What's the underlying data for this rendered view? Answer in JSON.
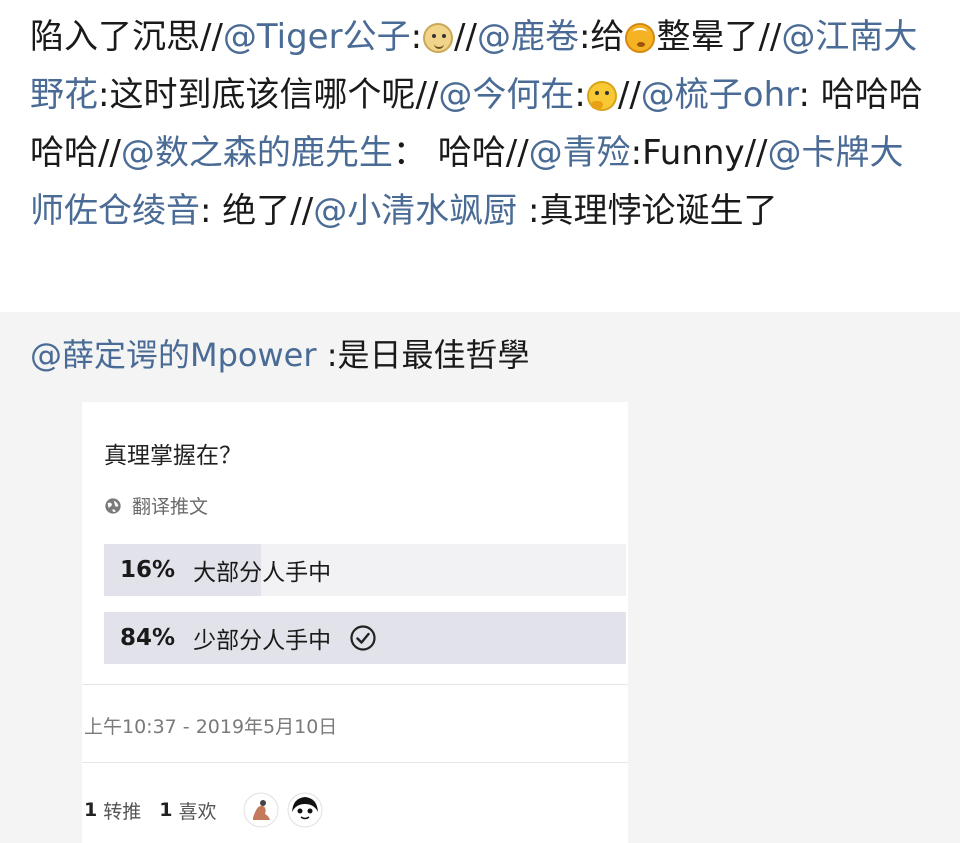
{
  "repost": {
    "segments": [
      {
        "type": "text",
        "text": "陷入了沉思"
      },
      {
        "type": "sep",
        "text": "//"
      },
      {
        "type": "mention",
        "text": "@Tiger公子"
      },
      {
        "type": "text",
        "text": ":"
      },
      {
        "type": "emoji",
        "icon": "doge-emoji-icon",
        "variant": "doge"
      },
      {
        "type": "sep",
        "text": "//"
      },
      {
        "type": "mention",
        "text": "@鹿卷"
      },
      {
        "type": "text",
        "text": ":给"
      },
      {
        "type": "emoji",
        "icon": "dizzy-face-emoji-icon",
        "variant": "dizzy"
      },
      {
        "type": "text",
        "text": "整晕了"
      },
      {
        "type": "sep",
        "text": "//"
      },
      {
        "type": "mention",
        "text": "@江南大野花"
      },
      {
        "type": "text",
        "text": ":这时到底该信哪个呢"
      },
      {
        "type": "sep",
        "text": "//"
      },
      {
        "type": "mention",
        "text": "@今何在"
      },
      {
        "type": "text",
        "text": ":"
      },
      {
        "type": "emoji",
        "icon": "thinking-emoji-icon",
        "variant": "think"
      },
      {
        "type": "sep",
        "text": "//"
      },
      {
        "type": "mention",
        "text": "@梳子ohr"
      },
      {
        "type": "text",
        "text": ": 哈哈哈哈哈"
      },
      {
        "type": "sep",
        "text": "//"
      },
      {
        "type": "mention",
        "text": "@数之森的鹿先生"
      },
      {
        "type": "text",
        "text": "： 哈哈"
      },
      {
        "type": "sep",
        "text": "//"
      },
      {
        "type": "mention",
        "text": "@青殓"
      },
      {
        "type": "text",
        "text": ":Funny"
      },
      {
        "type": "sep",
        "text": "//"
      },
      {
        "type": "mention",
        "text": "@卡牌大师佐仓绫音"
      },
      {
        "type": "text",
        "text": ": 绝了"
      },
      {
        "type": "sep",
        "text": "//"
      },
      {
        "type": "mention",
        "text": "@小清水飒厨"
      },
      {
        "type": "text",
        "text": " :真理悖论诞生了"
      }
    ]
  },
  "original": {
    "author": "@薛定谔的Mpower",
    "text": " :是日最佳哲學"
  },
  "tweet": {
    "question": "真理掌握在？",
    "translate_label": "翻译推文",
    "poll": [
      {
        "percent_label": "16%",
        "percent": 16,
        "label": "大部分人手中",
        "winner": false
      },
      {
        "percent_label": "84%",
        "percent": 84,
        "label": "少部分人手中",
        "winner": true
      }
    ],
    "timestamp": "上午10:37 - 2019年5月10日",
    "retweets_count": "1",
    "retweets_label": "转推",
    "likes_count": "1",
    "likes_label": "喜欢"
  },
  "colors": {
    "mention": "#4a6b95",
    "text": "#1a1a1a",
    "poll_fill": "#e2e3ea",
    "poll_track": "#f2f2f4"
  }
}
